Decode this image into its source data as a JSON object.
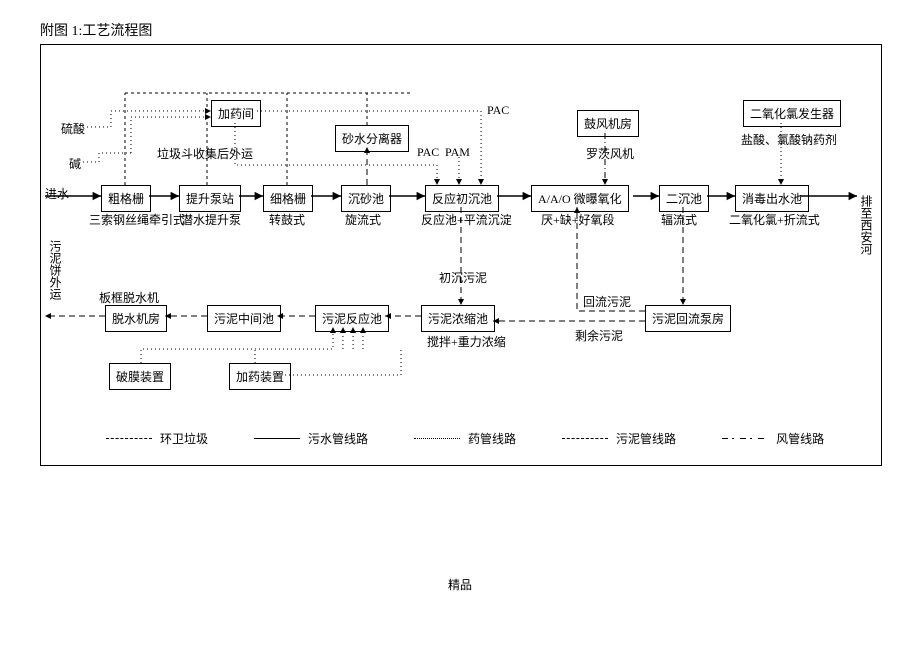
{
  "title": "附图 1:工艺流程图",
  "footer": "精品",
  "annotations": {
    "sulfuric_acid": "硫酸",
    "alkali": "碱",
    "trash_collect": "垃圾斗收集后外运",
    "pac": "PAC",
    "pac2": "PAC",
    "pam": "PAM",
    "roots_blower": "罗茨风机",
    "chem_hcl": "盐酸、氯酸钠药剂",
    "inflow": "进水",
    "outflow": "排至西安河",
    "cake": "污泥饼外运",
    "primary_sludge": "初沉污泥",
    "return_sludge": "回流污泥",
    "surplus_sludge": "剩余污泥",
    "mix_gravity": "搅拌+重力浓缩",
    "plate_dewater": "板框脱水机"
  },
  "nodes": {
    "dosing_room": "加药间",
    "sand_separator": "砂水分离器",
    "blower_room": "鼓风机房",
    "clo2_gen": "二氧化氯发生器",
    "coarse_screen": "粗格栅",
    "lift_pump": "提升泵站",
    "fine_screen": "细格栅",
    "grit_tank": "沉砂池",
    "react_primary": "反应初沉池",
    "aao": "A/A/O 微曝氧化",
    "sec_settle": "二沉池",
    "disinfect": "消毒出水池",
    "dewater_room": "脱水机房",
    "sludge_mid": "污泥中间池",
    "sludge_react": "污泥反应池",
    "sludge_thicken": "污泥浓缩池",
    "return_pump": "污泥回流泵房",
    "membrane_break": "破膜装置",
    "dosing_device": "加药装置"
  },
  "subs": {
    "coarse_screen": "三索钢丝绳牵引式",
    "lift_pump": "潜水提升泵",
    "fine_screen": "转鼓式",
    "grit_tank": "旋流式",
    "react_primary": "反应池+平流沉淀",
    "aao": "厌+缺+好氧段",
    "sec_settle": "辐流式",
    "disinfect": "二氧化氯+折流式"
  },
  "legend": {
    "garbage": "环卫垃圾",
    "sewer": "污水管线路",
    "chem": "药管线路",
    "sludge": "污泥管线路",
    "air": "风管线路"
  }
}
